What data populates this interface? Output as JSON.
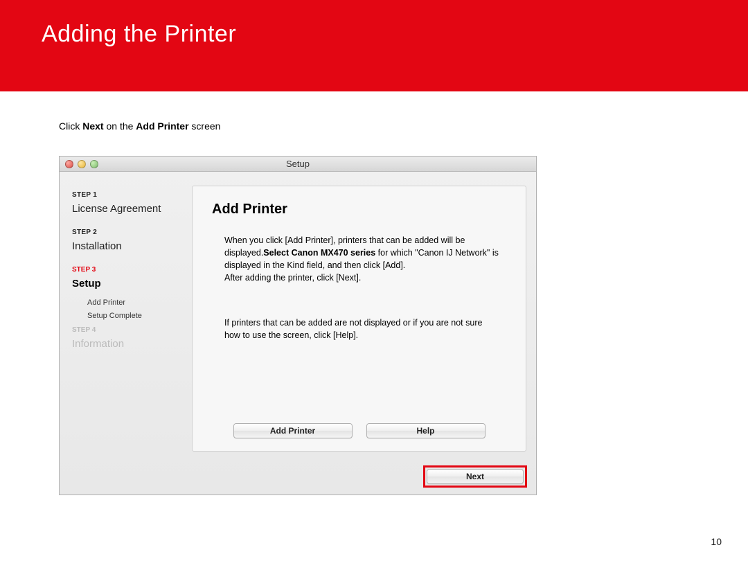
{
  "header": {
    "title": "Adding  the Printer"
  },
  "instruction": {
    "pre": "Click ",
    "bold1": "Next",
    "mid": " on the ",
    "bold2": "Add Printer",
    "post": " screen"
  },
  "window": {
    "title": "Setup",
    "sidebar": {
      "step1_label": "STEP 1",
      "step1_name": "License Agreement",
      "step2_label": "STEP 2",
      "step2_name": "Installation",
      "step3_label": "STEP 3",
      "step3_name": "Setup",
      "sub_add": "Add Printer",
      "sub_complete": "Setup Complete",
      "step4_label": "STEP 4",
      "step4_name": "Information"
    },
    "panel": {
      "title": "Add Printer",
      "para1_a": "When you click [Add Printer], printers that can be added will be displayed.",
      "para1_bold": "Select Canon MX470 series",
      "para1_b": " for which \"Canon IJ Network\" is displayed in the Kind field, and then click [Add].",
      "para1_c": "After adding the printer, click [Next].",
      "para2": "If printers that can be added are not displayed or if you are not sure how to use the screen, click [Help].",
      "btn_add": "Add Printer",
      "btn_help": "Help",
      "btn_next": "Next"
    }
  },
  "page_number": "10"
}
